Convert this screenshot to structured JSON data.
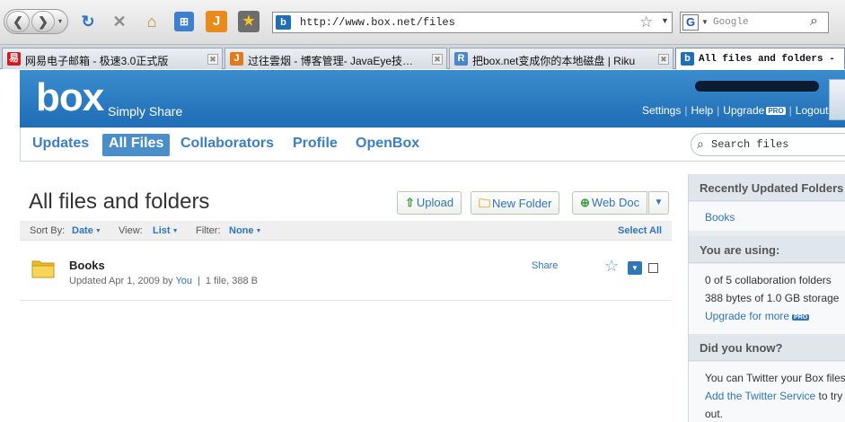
{
  "browser": {
    "url": "http://www.box.net/files",
    "search_placeholder": "Google",
    "tabs": [
      {
        "label": "网易电子邮箱 - 极速3.0正式版",
        "icon_color": "#d7191c",
        "icon_glyph": "易"
      },
      {
        "label": "过往雲烟 - 博客管理- JavaEye技…",
        "icon_color": "#e17a1c",
        "icon_glyph": "J"
      },
      {
        "label": "把box.net变成你的本地磁盘 | Riku",
        "icon_color": "#4b86c8",
        "icon_glyph": "R"
      },
      {
        "label": "All files and folders -",
        "icon_color": "#1f6fb7",
        "icon_glyph": "b"
      }
    ]
  },
  "header": {
    "logo": "box",
    "tagline": "Simply Share",
    "links": {
      "settings": "Settings",
      "help": "Help",
      "upgrade": "Upgrade",
      "pro_badge": "PRO",
      "logout": "Logout"
    }
  },
  "nav": {
    "items": [
      "Updates",
      "All Files",
      "Collaborators",
      "Profile",
      "OpenBox"
    ],
    "active": "All Files",
    "search_placeholder": "Search files"
  },
  "main": {
    "title": "All files and folders",
    "buttons": {
      "upload": "Upload",
      "new_folder": "New Folder",
      "web_doc": "Web Doc"
    },
    "sort": {
      "sort_label": "Sort By:",
      "sort_value": "Date",
      "view_label": "View:",
      "view_value": "List",
      "filter_label": "Filter:",
      "filter_value": "None",
      "select_all": "Select All"
    },
    "files": [
      {
        "name": "Books",
        "updated": "Updated Apr 1, 2009 by",
        "by": "You",
        "details": "1 file, 388 B",
        "share": "Share"
      }
    ]
  },
  "sidebar": {
    "recent_title": "Recently Updated Folders",
    "recent_items": [
      "Books"
    ],
    "using_title": "You are using:",
    "using_lines": [
      "0 of 5 collaboration folders",
      "388 bytes of 1.0 GB storage"
    ],
    "upgrade_link": "Upgrade for more",
    "pro_badge": "PRO",
    "know_title": "Did you know?",
    "know_text": "You can Twitter your Box files",
    "know_link": "Add the Twitter Service",
    "know_tail": "to try i",
    "know_out": "out."
  }
}
